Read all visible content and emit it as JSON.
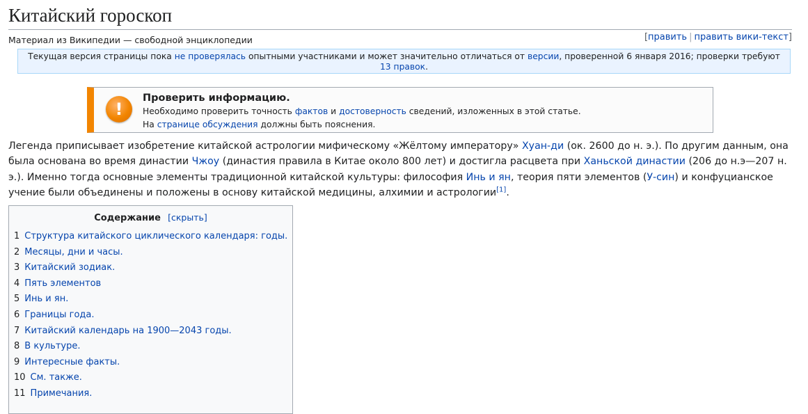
{
  "page": {
    "title": "Китайский гороскоп",
    "tagline": "Материал из Википедии — свободной энциклопедии",
    "edit_links": {
      "edit": "править",
      "edit_source": "править вики-текст"
    }
  },
  "flagged": {
    "t1": "Текущая версия страницы пока ",
    "l1": "не проверялась",
    "t2": " опытными участниками и может значительно отличаться от ",
    "l2": "версии",
    "t3": ", проверенной 6 января 2016; проверки требуют ",
    "l3": "13 правок",
    "t4": "."
  },
  "ambox": {
    "title": "Проверить информацию.",
    "l1_t1": "Необходимо проверить точность ",
    "l1_link1": "фактов",
    "l1_t2": " и ",
    "l1_link2": "достоверность",
    "l1_t3": " сведений, изложенных в этой статье.",
    "l2_t1": "На ",
    "l2_link": "странице обсуждения",
    "l2_t2": " должны быть пояснения.",
    "icon_symbol": "!"
  },
  "lead": {
    "t1": "Легенда приписывает изобретение китайской астрологии мифическому «Жёлтому императору» ",
    "l1": "Хуан-ди",
    "t2": " (ок. 2600 до н. э.). По другим данным, она была основана во время династии ",
    "l2": "Чжоу",
    "t3": " (династия правила в Китае около 800 лет) и достигла расцвета при ",
    "l3": "Ханьской династии",
    "t4": " (206 до н.э—207 н. э.). Именно тогда основные элементы традиционной китайской культуры: философия ",
    "l4": "Инь и ян",
    "t5": ", теория пяти элементов (",
    "l5": "У-син",
    "t6": ") и конфуцианское учение были объединены и положены в основу китайской медицины, алхимии и астрологии",
    "ref": "[1]",
    "t7": "."
  },
  "toc": {
    "title": "Содержание",
    "toggle": "[скрыть]",
    "items": [
      {
        "num": "1",
        "label": "Структура китайского циклического календаря: годы."
      },
      {
        "num": "2",
        "label": "Месяцы, дни и часы."
      },
      {
        "num": "3",
        "label": "Китайский зодиак."
      },
      {
        "num": "4",
        "label": "Пять элементов"
      },
      {
        "num": "5",
        "label": "Инь и ян."
      },
      {
        "num": "6",
        "label": "Границы года."
      },
      {
        "num": "7",
        "label": "Китайский календарь на 1900—2043 годы."
      },
      {
        "num": "8",
        "label": "В культуре."
      },
      {
        "num": "9",
        "label": "Интересные факты."
      },
      {
        "num": "10",
        "label": "См. также."
      },
      {
        "num": "11",
        "label": "Примечания."
      }
    ]
  },
  "colors": {
    "link": "#0645ad",
    "warning": "#f28500",
    "flagged_bg": "#eaf3ff",
    "toc_bg": "#f8f9fa"
  }
}
